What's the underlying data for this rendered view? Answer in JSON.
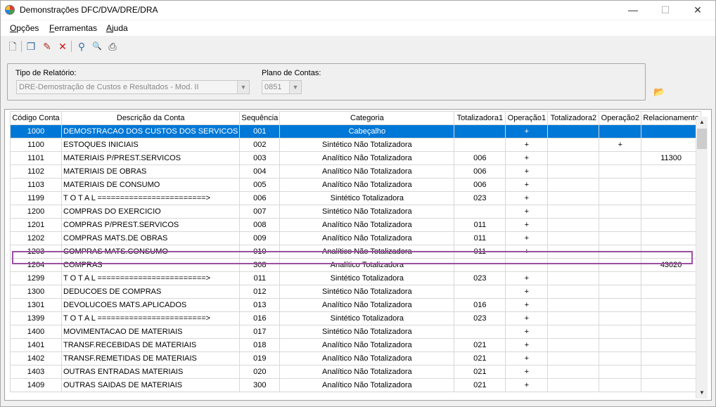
{
  "window": {
    "title": "Demonstrações DFC/DVA/DRE/DRA",
    "minimize_glyph": "—",
    "maximize_glyph": "☐",
    "close_glyph": "✕"
  },
  "menu": [
    {
      "label": "Opções",
      "accel": "O",
      "rest": "pções"
    },
    {
      "label": "Ferramentas",
      "accel": "F",
      "rest": "erramentas"
    },
    {
      "label": "Ajuda",
      "accel": "A",
      "rest": "juda"
    }
  ],
  "toolbar": [
    {
      "icon": "new-document-icon",
      "glyph": "🗋"
    },
    {
      "icon": "copy-icon",
      "glyph": "❐"
    },
    {
      "icon": "edit-icon",
      "glyph": "✎"
    },
    {
      "icon": "delete-icon",
      "glyph": "✕"
    },
    {
      "icon": "search-icon",
      "glyph": "⚲"
    },
    {
      "icon": "find-icon",
      "glyph": "🔍"
    },
    {
      "icon": "print-icon",
      "glyph": "⎙"
    }
  ],
  "filters": {
    "report_type_label": "Tipo de Relatório:",
    "report_type_value": "DRE-Demostração de Custos e Resultados - Mod. II",
    "chart_label": "Plano de Contas:",
    "chart_value": "0851"
  },
  "grid": {
    "columns": [
      "Código Conta",
      "Descrição da Conta",
      "Sequência",
      "Categoria",
      "Totalizadora1",
      "Operação1",
      "Totalizadora2",
      "Operação2",
      "Relacionamento"
    ],
    "rows": [
      [
        "1000",
        "DEMOSTRACAO DOS CUSTOS DOS SERVICOS",
        "001",
        "Cabeçalho",
        "",
        "+",
        "",
        "",
        ""
      ],
      [
        "1100",
        "ESTOQUES INICIAIS",
        "002",
        "Sintético Não Totalizadora",
        "",
        "+",
        "",
        "+",
        ""
      ],
      [
        "1101",
        "MATERIAIS P/PREST.SERVICOS",
        "003",
        "Analítico Não Totalizadora",
        "006",
        "+",
        "",
        "",
        "11300"
      ],
      [
        "1102",
        "MATERIAIS DE OBRAS",
        "004",
        "Analítico Não Totalizadora",
        "006",
        "+",
        "",
        "",
        ""
      ],
      [
        "1103",
        "MATERIAIS DE CONSUMO",
        "005",
        "Analítico Não Totalizadora",
        "006",
        "+",
        "",
        "",
        ""
      ],
      [
        "1199",
        "T O T A L ========================>",
        "006",
        "Sintético Totalizadora",
        "023",
        "+",
        "",
        "",
        ""
      ],
      [
        "1200",
        "COMPRAS DO EXERCICIO",
        "007",
        "Sintético Não Totalizadora",
        "",
        "+",
        "",
        "",
        ""
      ],
      [
        "1201",
        "COMPRAS P/PREST.SERVICOS",
        "008",
        "Analítico Não Totalizadora",
        "011",
        "+",
        "",
        "",
        ""
      ],
      [
        "1202",
        "COMPRAS MATS.DE OBRAS",
        "009",
        "Analítico Não Totalizadora",
        "011",
        "+",
        "",
        "",
        ""
      ],
      [
        "1203",
        "COMPRAS MATS.CONSUMO",
        "010",
        "Analítico Não Totalizadora",
        "011",
        "+",
        "",
        "",
        ""
      ],
      [
        "1204",
        "COMPRAS",
        "308",
        "Analítico Totalizadora",
        "",
        "",
        "",
        "",
        "43020"
      ],
      [
        "1299",
        "T O T A L ========================>",
        "011",
        "Sintético Totalizadora",
        "023",
        "+",
        "",
        "",
        ""
      ],
      [
        "1300",
        "DEDUCOES DE COMPRAS",
        "012",
        "Sintético Não Totalizadora",
        "",
        "+",
        "",
        "",
        ""
      ],
      [
        "1301",
        "DEVOLUCOES MATS.APLICADOS",
        "013",
        "Analítico Não Totalizadora",
        "016",
        "+",
        "",
        "",
        ""
      ],
      [
        "1399",
        "T O T A L ========================>",
        "016",
        "Sintético Totalizadora",
        "023",
        "+",
        "",
        "",
        ""
      ],
      [
        "1400",
        "MOVIMENTACAO DE MATERIAIS",
        "017",
        "Sintético Não Totalizadora",
        "",
        "+",
        "",
        "",
        ""
      ],
      [
        "1401",
        "TRANSF.RECEBIDAS DE MATERIAIS",
        "018",
        "Analítico Não Totalizadora",
        "021",
        "+",
        "",
        "",
        ""
      ],
      [
        "1402",
        "TRANSF.REMETIDAS DE MATERIAIS",
        "019",
        "Analítico Não Totalizadora",
        "021",
        "+",
        "",
        "",
        ""
      ],
      [
        "1403",
        "OUTRAS ENTRADAS MATERIAIS",
        "020",
        "Analítico Não Totalizadora",
        "021",
        "+",
        "",
        "",
        ""
      ],
      [
        "1409",
        "OUTRAS SAIDAS DE MATERIAIS",
        "300",
        "Analítico Não Totalizadora",
        "021",
        "+",
        "",
        "",
        ""
      ]
    ]
  },
  "colors": {
    "selection": "#0078d7",
    "highlight_box": "#9b4fa0"
  }
}
